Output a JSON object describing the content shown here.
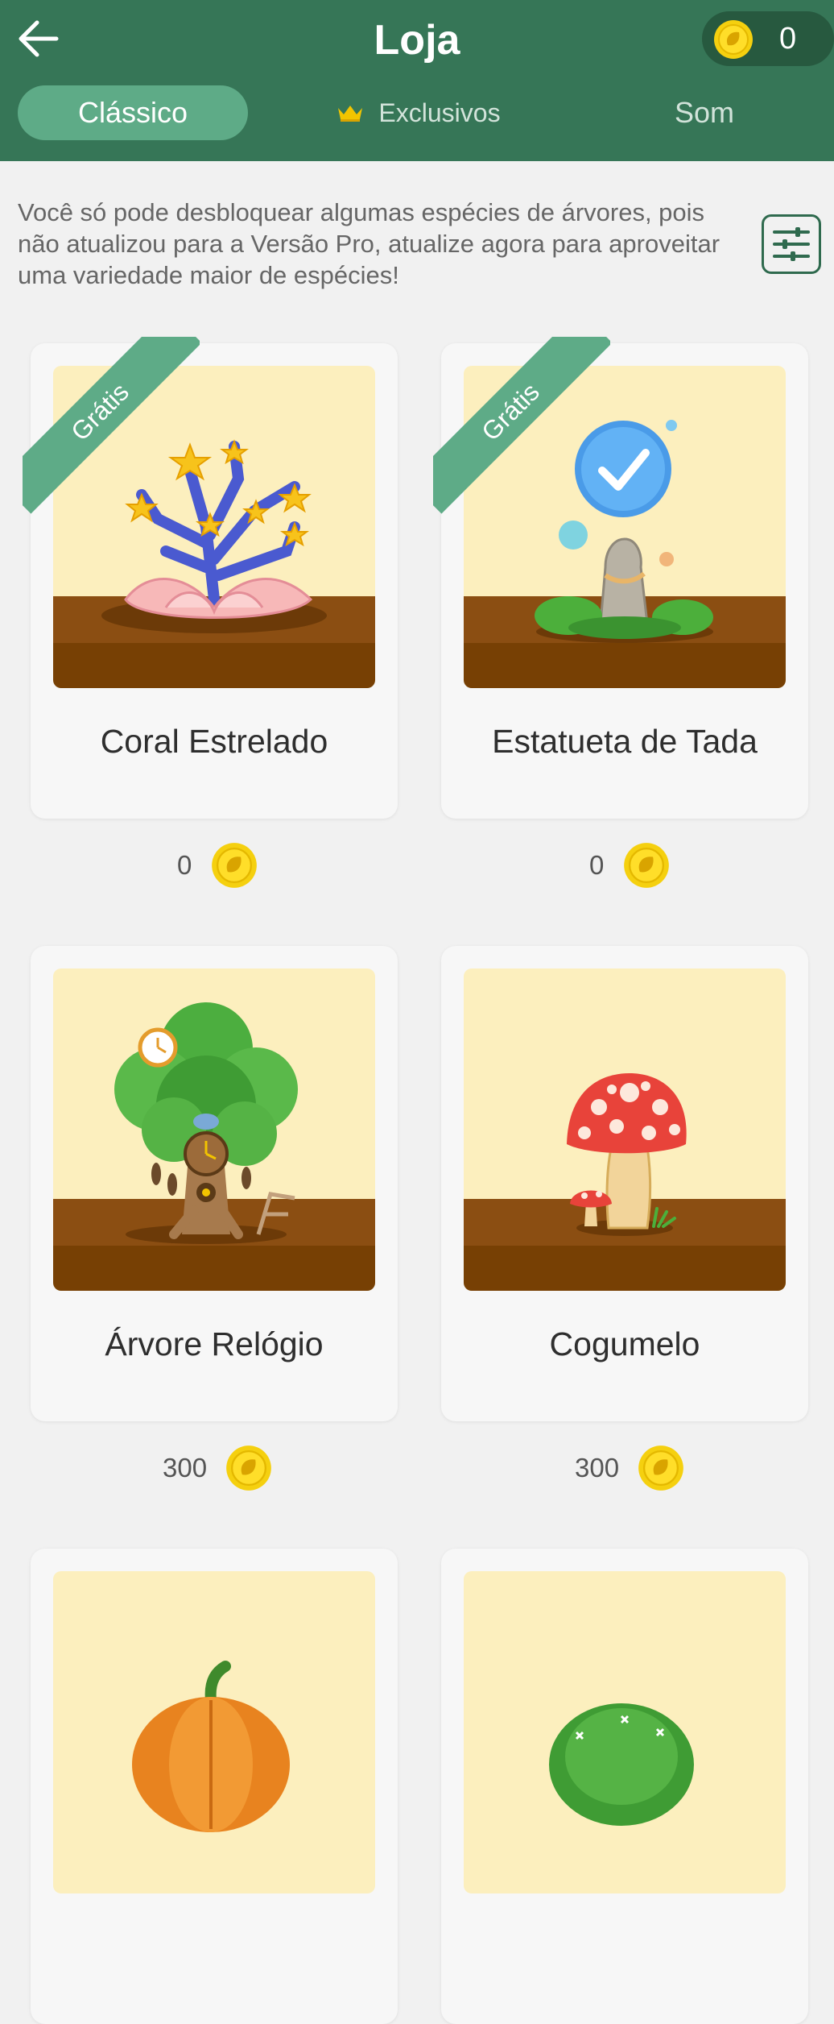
{
  "header": {
    "title": "Loja",
    "coin_balance": "0",
    "back_icon": "arrow-left-icon"
  },
  "tabs": [
    {
      "label": "Clássico",
      "active": true
    },
    {
      "label": "Exclusivos",
      "icon": "crown-icon",
      "active": false
    },
    {
      "label": "Som",
      "active": false
    }
  ],
  "notice": {
    "text": "Você só pode desbloquear algumas espécies de árvores, pois não atualizou para a Versão Pro, atualize agora para aproveitar uma variedade maior de espécies!",
    "filter_icon": "sliders-icon"
  },
  "items": [
    {
      "name": "Coral Estrelado",
      "price": "0",
      "badge": "Grátis",
      "icon": "starry-coral-icon"
    },
    {
      "name": "Estatueta de Tada",
      "price": "0",
      "badge": "Grátis",
      "icon": "tada-statue-icon"
    },
    {
      "name": "Árvore Relógio",
      "price": "300",
      "icon": "clock-tree-icon"
    },
    {
      "name": "Cogumelo",
      "price": "300",
      "icon": "mushroom-icon"
    },
    {
      "name": "",
      "price": "",
      "icon": "pumpkin-icon"
    },
    {
      "name": "",
      "price": "",
      "icon": "green-bush-icon"
    }
  ],
  "colors": {
    "header_bg": "#367657",
    "tab_active_bg": "#5eab87",
    "coin": "#f5d00f",
    "card_art_bg": "#fcefbe",
    "soil": "#8b4e12"
  }
}
